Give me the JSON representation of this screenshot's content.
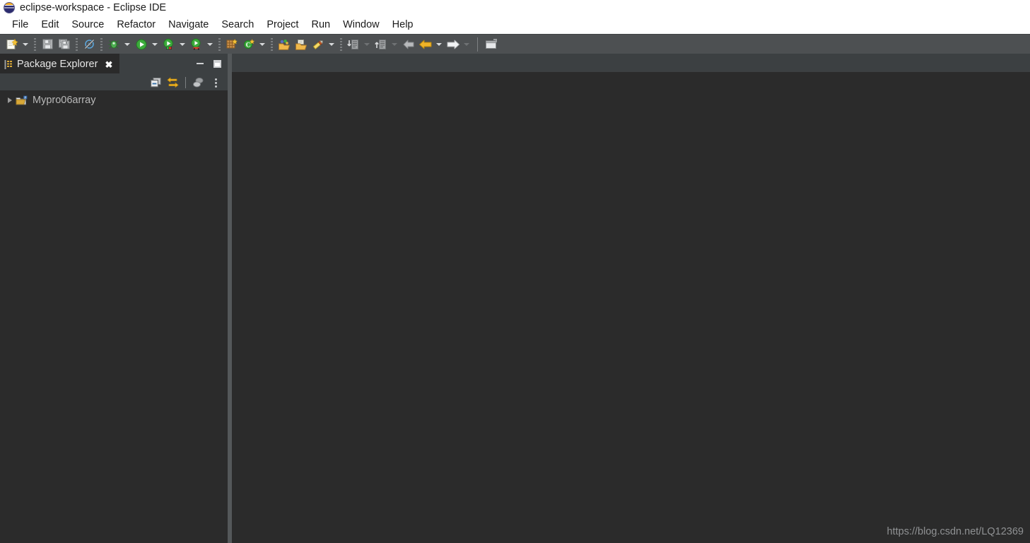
{
  "window": {
    "title": "eclipse-workspace - Eclipse IDE",
    "logo_icon": "eclipse-logo-icon"
  },
  "menubar": {
    "items": [
      {
        "label": "File"
      },
      {
        "label": "Edit"
      },
      {
        "label": "Source"
      },
      {
        "label": "Refactor"
      },
      {
        "label": "Navigate"
      },
      {
        "label": "Search"
      },
      {
        "label": "Project"
      },
      {
        "label": "Run"
      },
      {
        "label": "Window"
      },
      {
        "label": "Help"
      }
    ]
  },
  "toolbar": {
    "items": [
      {
        "name": "new-wizard-button",
        "icon": "new-file-icon"
      },
      {
        "name": "new-wizard-dropdown",
        "icon": "chevron-down-icon"
      },
      {
        "name": "separator-1",
        "icon": "separator-icon"
      },
      {
        "name": "save-button",
        "icon": "save-floppy-icon"
      },
      {
        "name": "save-all-button",
        "icon": "save-all-icon"
      },
      {
        "name": "separator-2",
        "icon": "separator-icon"
      },
      {
        "name": "toggle-mark-occurrences-button",
        "icon": "crossed-circle-icon"
      },
      {
        "name": "separator-3",
        "icon": "separator-icon"
      },
      {
        "name": "debug-button",
        "icon": "debug-bug-icon"
      },
      {
        "name": "debug-dropdown",
        "icon": "chevron-down-icon"
      },
      {
        "name": "run-button",
        "icon": "run-play-icon"
      },
      {
        "name": "run-dropdown",
        "icon": "chevron-down-icon"
      },
      {
        "name": "coverage-button",
        "icon": "coverage-play-icon"
      },
      {
        "name": "coverage-dropdown",
        "icon": "chevron-down-icon"
      },
      {
        "name": "profile-button",
        "icon": "profile-play-icon"
      },
      {
        "name": "profile-dropdown",
        "icon": "chevron-down-icon"
      },
      {
        "name": "separator-4",
        "icon": "separator-icon"
      },
      {
        "name": "new-java-package-button",
        "icon": "new-package-icon"
      },
      {
        "name": "new-java-class-button",
        "icon": "new-class-icon"
      },
      {
        "name": "new-java-class-dropdown",
        "icon": "chevron-down-icon"
      },
      {
        "name": "separator-5",
        "icon": "separator-icon"
      },
      {
        "name": "open-type-button",
        "icon": "open-type-icon"
      },
      {
        "name": "open-task-button",
        "icon": "open-folder-icon"
      },
      {
        "name": "search-button",
        "icon": "pencil-search-icon"
      },
      {
        "name": "search-dropdown",
        "icon": "chevron-down-icon"
      },
      {
        "name": "separator-6",
        "icon": "separator-icon"
      },
      {
        "name": "next-annotation-button",
        "icon": "next-annotation-icon"
      },
      {
        "name": "next-annotation-dropdown",
        "icon": "chevron-down-icon"
      },
      {
        "name": "previous-annotation-button",
        "icon": "previous-annotation-icon"
      },
      {
        "name": "previous-annotation-dropdown",
        "icon": "chevron-down-icon"
      },
      {
        "name": "last-edit-location-button",
        "icon": "back-arrow-gray-icon"
      },
      {
        "name": "back-button",
        "icon": "back-arrow-icon"
      },
      {
        "name": "back-dropdown",
        "icon": "chevron-down-icon"
      },
      {
        "name": "forward-button",
        "icon": "forward-arrow-icon"
      },
      {
        "name": "forward-dropdown",
        "icon": "chevron-down-icon"
      },
      {
        "name": "divider-line",
        "icon": "divider-icon"
      },
      {
        "name": "open-perspective-button",
        "icon": "open-perspective-icon"
      }
    ]
  },
  "package_explorer": {
    "tab_label": "Package Explorer",
    "tab_icon": "package-explorer-icon",
    "close_label": "✖",
    "minimize_label": "minimize-icon",
    "maximize_label": "maximize-icon",
    "view_toolbar": [
      {
        "name": "collapse-all-button",
        "icon": "collapse-all-icon"
      },
      {
        "name": "link-with-editor-button",
        "icon": "link-with-editor-icon"
      },
      {
        "name": "focus-on-active-task-button",
        "icon": "focus-active-task-icon"
      },
      {
        "name": "view-menu-button",
        "icon": "view-menu-icon"
      }
    ],
    "tree": [
      {
        "label": "Mypro06array",
        "icon": "java-project-icon",
        "expanded": false,
        "twisty": "chevron-right-icon"
      }
    ]
  },
  "editor": {
    "watermark": "https://blog.csdn.net/LQ12369"
  },
  "colors": {
    "titlebar_bg": "#ffffff",
    "menubar_bg": "#ffffff",
    "toolbar_bg": "#4d5052",
    "panel_bg": "#3c4042",
    "editor_bg": "#2b2b2b",
    "tab_active_bg": "#2a2a2a",
    "text_light": "#e6e6e6",
    "text_muted": "#b9b9b9",
    "sash": "#54585a",
    "accent_gold": "#f0a81e",
    "accent_green": "#22a022"
  }
}
